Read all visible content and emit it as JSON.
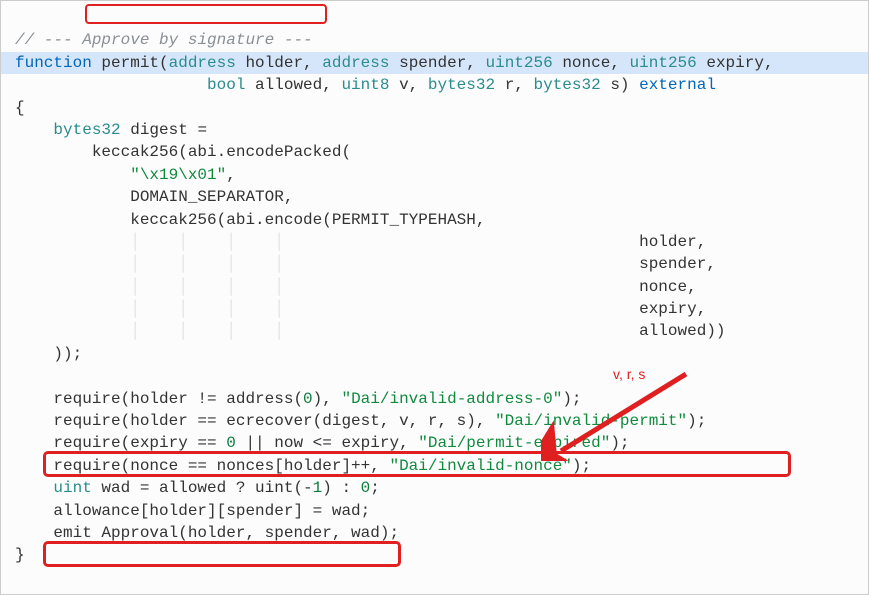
{
  "annotation": {
    "label": "v, r, s"
  },
  "code": {
    "l1_pre": "// --- ",
    "l1_mid": "Approve by signature",
    "l1_post": " ---",
    "l2_fn": "function",
    "l2_name": " permit(",
    "l2_p1t": "address",
    "l2_p1n": " holder, ",
    "l2_p2t": "address",
    "l2_p2n": " spender, ",
    "l2_p3t": "uint256",
    "l2_p3n": " nonce, ",
    "l2_p4t": "uint256",
    "l2_p4n": " expiry,",
    "l3_ind": "                    ",
    "l3_p5t": "bool",
    "l3_p5n": " allowed, ",
    "l3_p6t": "uint8",
    "l3_p6n": " v, ",
    "l3_p7t": "bytes32",
    "l3_p7n": " r, ",
    "l3_p8t": "bytes32",
    "l3_p8n": " s) ",
    "l3_ext": "external",
    "l4": "{",
    "l5_ind": "    ",
    "l5_t": "bytes32",
    "l5_rest": " digest =",
    "l6": "        keccak256(abi.encodePacked(",
    "l7_ind": "            ",
    "l7_str": "\"\\x19\\x01\"",
    "l7_c": ",",
    "l8": "            DOMAIN_SEPARATOR,",
    "l9": "            keccak256(abi.encode(PERMIT_TYPEHASH,",
    "l10": "                                 holder,",
    "l11": "                                 spender,",
    "l12": "                                 nonce,",
    "l13": "                                 expiry,",
    "l14": "                                 allowed))",
    "l15": "    ));",
    "l16": "",
    "l17a": "    require(holder != address(",
    "l17n": "0",
    "l17b": "), ",
    "l17s": "\"Dai/invalid-address-0\"",
    "l17c": ");",
    "l18a": "    require(holder == ecrecover(digest, v, r, s), ",
    "l18s": "\"Dai/invalid-permit\"",
    "l18c": ");",
    "l19a": "    require(expiry == ",
    "l19n1": "0",
    "l19b": " || now <= expiry, ",
    "l19s": "\"Dai/permit-expired\"",
    "l19c": ");",
    "l20a": "    require(nonce == nonces[holder]++, ",
    "l20s": "\"Dai/invalid-nonce\"",
    "l20c": ");",
    "l21_ind": "    ",
    "l21_t": "uint",
    "l21_a": " wad = allowed ? uint(-",
    "l21_n1": "1",
    "l21_b": ") : ",
    "l21_n2": "0",
    "l21_c": ";",
    "l22": "    allowance[holder][spender] = wad;",
    "l23": "    emit Approval(holder, spender, wad);",
    "l24": "}"
  }
}
